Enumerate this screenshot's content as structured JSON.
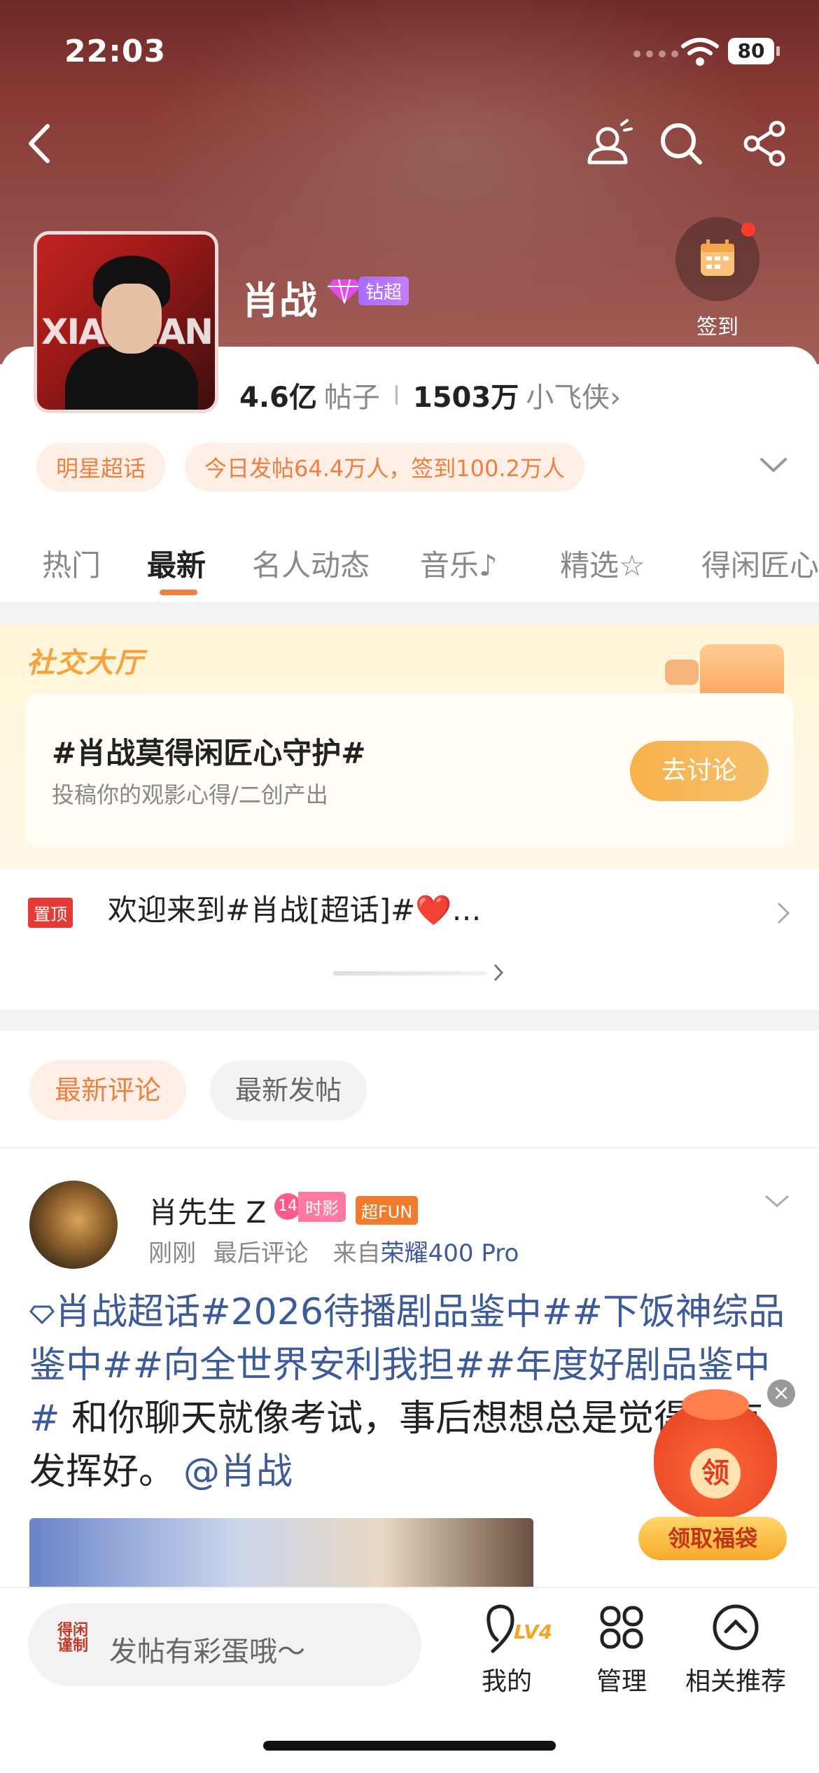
{
  "status_bar": {
    "time": "22:03",
    "battery": "80"
  },
  "header": {
    "title": "肖战",
    "level_tag": "钻超",
    "checkin_label": "签到",
    "avatar_text_left": "XIAO",
    "avatar_text_right": "ZHAN"
  },
  "stats": {
    "posts_value": "4.6亿",
    "posts_unit": "帖子",
    "fans_value": "1503万",
    "fans_unit": "小飞侠›"
  },
  "chips": [
    "明星超话",
    "今日发帖64.4万人，签到100.2万人"
  ],
  "tabs": [
    {
      "label": "热门",
      "active": false
    },
    {
      "label": "最新",
      "active": true
    },
    {
      "label": "名人动态",
      "active": false
    },
    {
      "label": "音乐♪",
      "active": false
    },
    {
      "label": "精选☆",
      "active": false
    },
    {
      "label": "得闲匠心",
      "active": false
    }
  ],
  "social_hall": {
    "title": "社交大厅",
    "topic": "#肖战莫得闲匠心守护#",
    "subtitle": "投稿你的观影心得/二创产出",
    "button": "去讨论"
  },
  "pinned": {
    "tag": "置顶",
    "text": "欢迎来到#肖战[超话]#❤️…"
  },
  "sort": {
    "selected": "最新评论",
    "other": "最新发帖"
  },
  "post": {
    "author": "肖先生 Z",
    "badge_num": "14",
    "badge_time": "时影",
    "badge_fun": "超FUN",
    "meta_time": "刚刚",
    "meta_action": "最后评论",
    "meta_from": "来自",
    "meta_device": "荣耀400 Pro",
    "body_links": "肖战超话#2026待播剧品鉴中##下饭神综品鉴中##向全世界安利我担##年度好剧品鉴中#",
    "body_text": " 和你聊天就像考试，事后想想总是觉得没有发挥好。",
    "mention": "@肖战"
  },
  "lucky_bag": {
    "coin": "领",
    "button": "领取福袋",
    "close": "×"
  },
  "bottom_bar": {
    "logo": "得闲谨制",
    "compose_placeholder": "发帖有彩蛋哦～",
    "mine_level": "LV4",
    "mine": "我的",
    "manage": "管理",
    "related": "相关推荐"
  }
}
